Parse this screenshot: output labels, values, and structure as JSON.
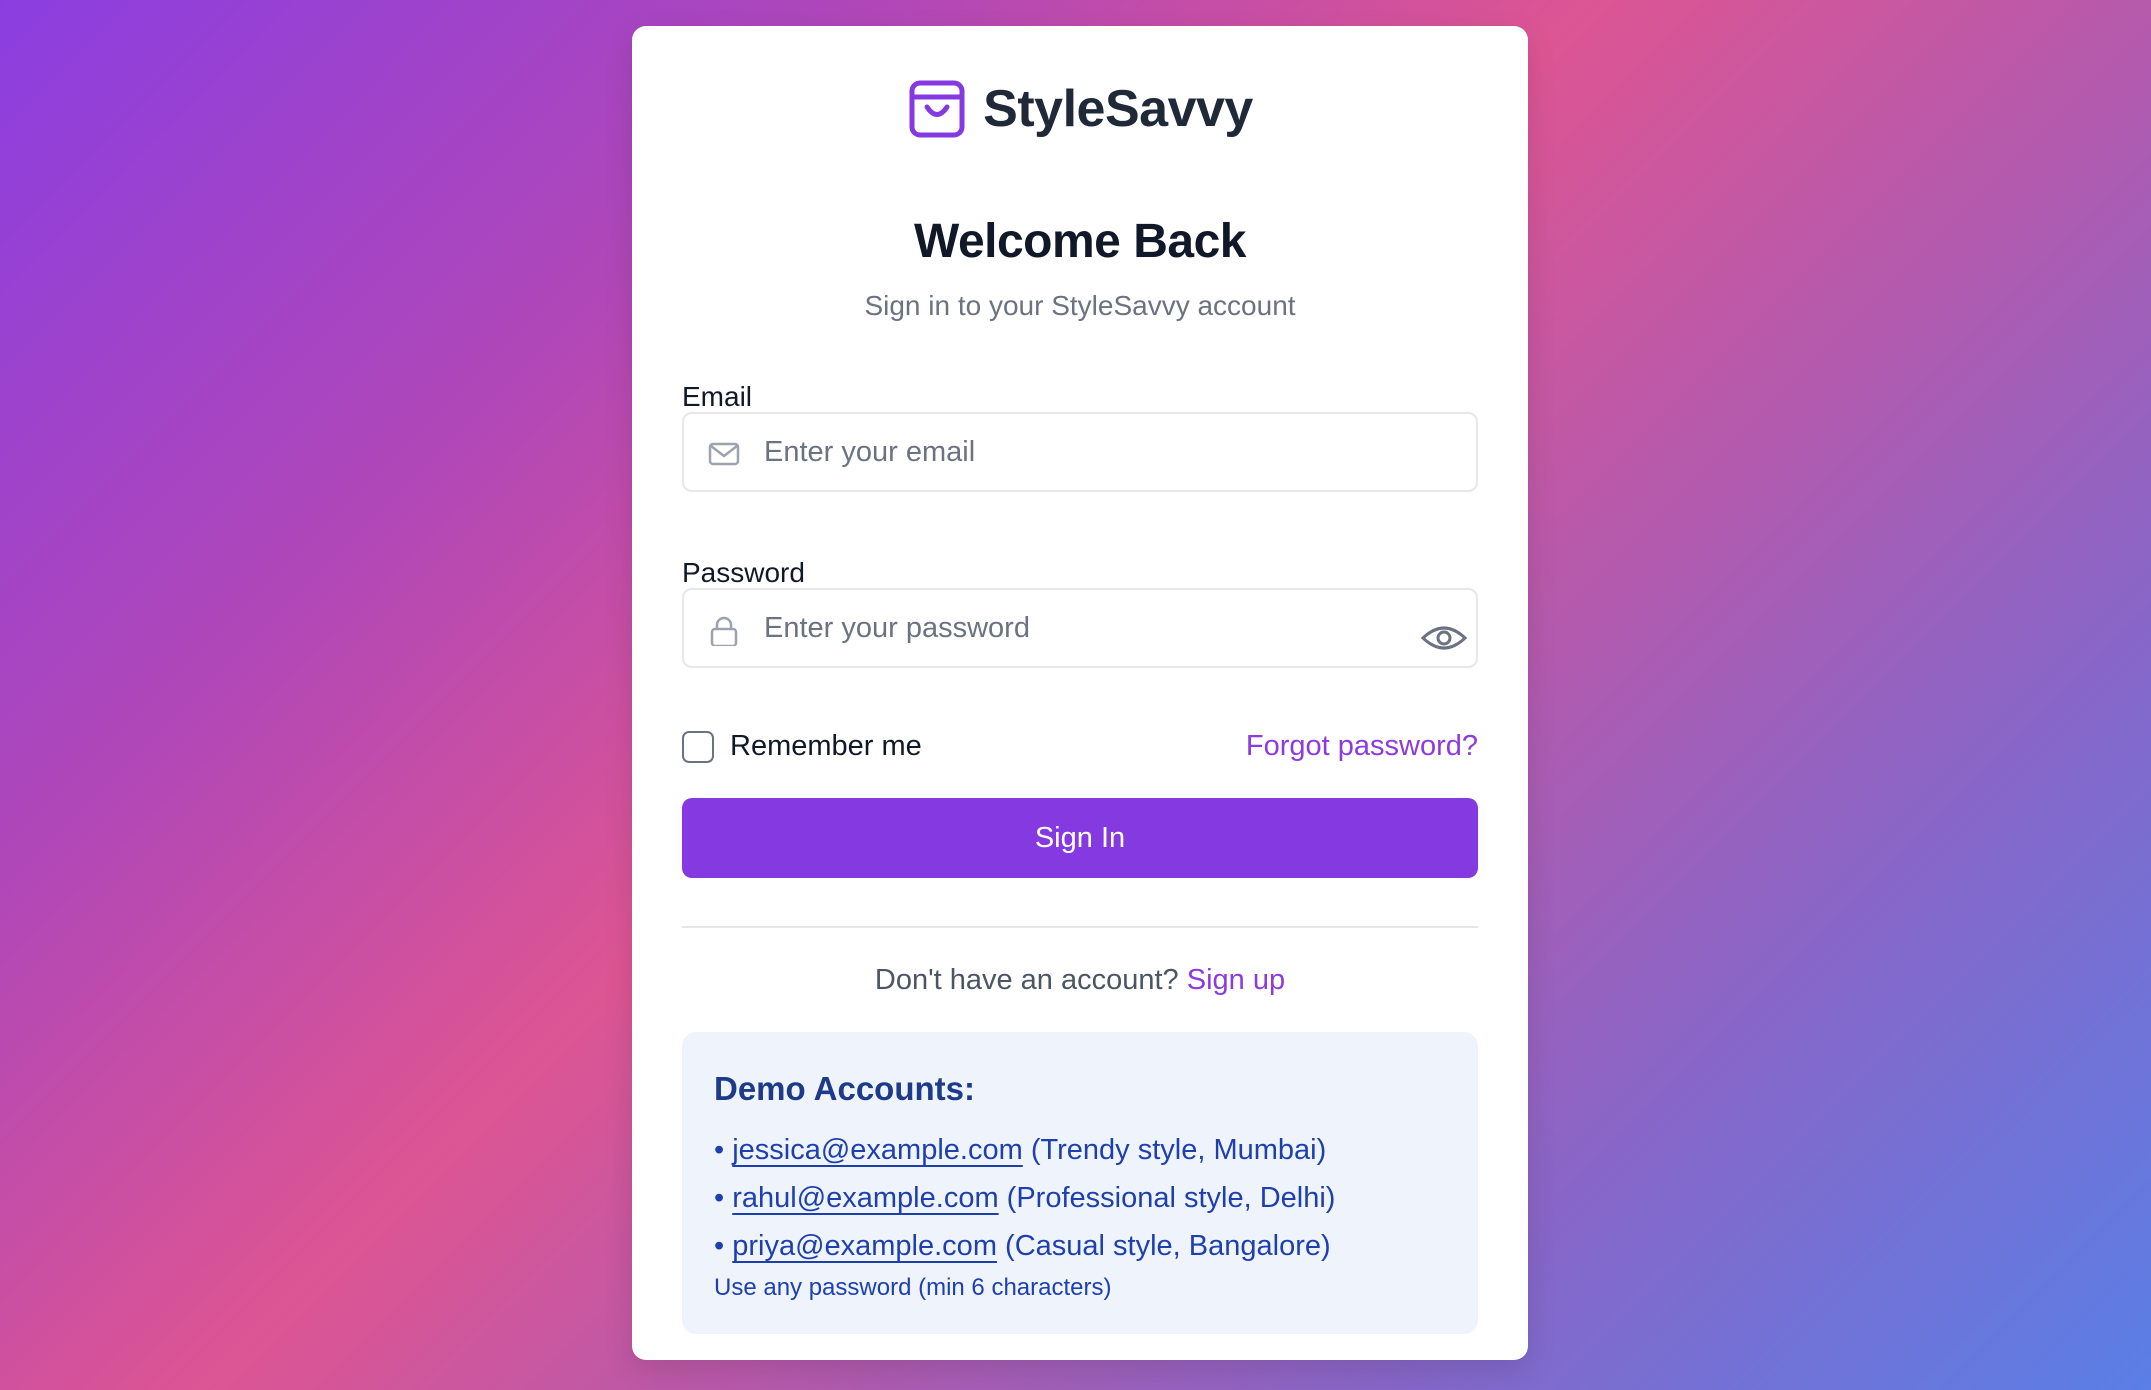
{
  "brand": {
    "name": "StyleSavvy",
    "icon": "shopping-bag-icon",
    "color": "#8539e1"
  },
  "heading": {
    "title": "Welcome Back",
    "subtitle": "Sign in to your StyleSavvy account"
  },
  "form": {
    "email": {
      "label": "Email",
      "placeholder": "Enter your email",
      "icon": "mail-icon"
    },
    "password": {
      "label": "Password",
      "placeholder": "Enter your password",
      "icon": "lock-icon",
      "toggle_icon": "eye-icon"
    },
    "remember_label": "Remember me",
    "remember_checked": false,
    "forgot_label": "Forgot password?",
    "submit_label": "Sign In"
  },
  "signup": {
    "prompt": "Don't have an account?",
    "link": "Sign up"
  },
  "demo": {
    "title": "Demo Accounts:",
    "accounts": [
      {
        "bullet": "•",
        "email": "jessica@example.com",
        "desc": "(Trendy style, Mumbai)"
      },
      {
        "bullet": "•",
        "email": "rahul@example.com",
        "desc": "(Professional style, Delhi)"
      },
      {
        "bullet": "•",
        "email": "priya@example.com",
        "desc": "(Casual style, Bangalore)"
      }
    ],
    "note": "Use any password (min 6 characters)"
  },
  "colors": {
    "accent": "#8539e1",
    "link": "#8b3be0",
    "demo_bg": "#eff4fc",
    "demo_text": "#1e40af"
  }
}
